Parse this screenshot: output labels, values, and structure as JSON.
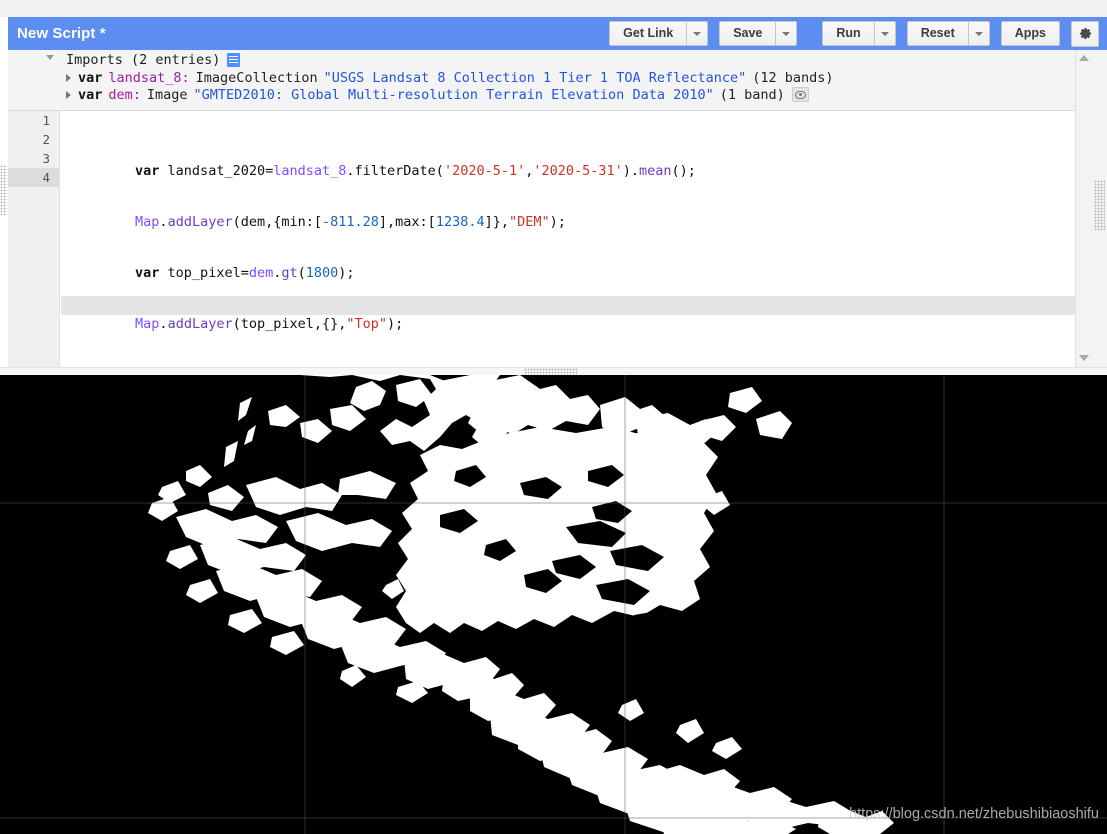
{
  "app": {
    "script_title": "New Script *"
  },
  "toolbar": {
    "get_link_label": "Get Link",
    "save_label": "Save",
    "run_label": "Run",
    "reset_label": "Reset",
    "apps_label": "Apps",
    "settings_icon": "gear-icon",
    "accent_color": "#5b8ef0"
  },
  "imports": {
    "title": "Imports (2 entries)",
    "list_icon": "document-list-icon",
    "entries": [
      {
        "keyword": "var",
        "name": "landsat_8:",
        "type": "ImageCollection",
        "description": "\"USGS Landsat 8 Collection 1 Tier 1 TOA Reflectance\"",
        "bands": "(12 bands)",
        "has_eye": false
      },
      {
        "keyword": "var",
        "name": "dem:",
        "type": "Image",
        "description": "\"GMTED2010: Global Multi-resolution Terrain Elevation Data 2010\"",
        "bands": "(1 band)",
        "has_eye": true,
        "eye_icon": "eye-icon"
      }
    ]
  },
  "editor": {
    "line_numbers": [
      "1",
      "2",
      "3",
      "4"
    ],
    "active_line": 4,
    "lines": [
      {
        "number": "1",
        "tokens": [
          {
            "t": "kw",
            "v": "var"
          },
          {
            "t": "plain",
            "v": " landsat_2020="
          },
          {
            "t": "obj",
            "v": "landsat_8"
          },
          {
            "t": "plain",
            "v": "."
          },
          {
            "t": "prop",
            "v": "filterDate"
          },
          {
            "t": "plain",
            "v": "("
          },
          {
            "t": "str",
            "v": "'2020-5-1'"
          },
          {
            "t": "plain",
            "v": ","
          },
          {
            "t": "str",
            "v": "'2020-5-31'"
          },
          {
            "t": "plain",
            "v": ")."
          },
          {
            "t": "fn",
            "v": "mean"
          },
          {
            "t": "plain",
            "v": "();"
          }
        ]
      },
      {
        "number": "2",
        "tokens": [
          {
            "t": "obj",
            "v": "Map"
          },
          {
            "t": "plain",
            "v": "."
          },
          {
            "t": "fn",
            "v": "addLayer"
          },
          {
            "t": "plain",
            "v": "(dem,{min:["
          },
          {
            "t": "num",
            "v": "-811.28"
          },
          {
            "t": "plain",
            "v": "],max:["
          },
          {
            "t": "num",
            "v": "1238.4"
          },
          {
            "t": "plain",
            "v": "]},"
          },
          {
            "t": "str",
            "v": "\"DEM\""
          },
          {
            "t": "plain",
            "v": ");"
          }
        ]
      },
      {
        "number": "3",
        "tokens": [
          {
            "t": "kw",
            "v": "var"
          },
          {
            "t": "plain",
            "v": " top_pixel="
          },
          {
            "t": "obj",
            "v": "dem"
          },
          {
            "t": "plain",
            "v": "."
          },
          {
            "t": "fn",
            "v": "gt"
          },
          {
            "t": "plain",
            "v": "("
          },
          {
            "t": "num",
            "v": "1800"
          },
          {
            "t": "plain",
            "v": ");"
          }
        ]
      },
      {
        "number": "4",
        "tokens": [
          {
            "t": "obj",
            "v": "Map"
          },
          {
            "t": "plain",
            "v": "."
          },
          {
            "t": "fn",
            "v": "addLayer"
          },
          {
            "t": "plain",
            "v": "(top_pixel,{},"
          },
          {
            "t": "str",
            "v": "\"Top\""
          },
          {
            "t": "plain",
            "v": ");"
          }
        ]
      }
    ],
    "raw_text": "var landsat_2020=landsat_8.filterDate('2020-5-1','2020-5-31').mean();\nMap.addLayer(dem,{min:[-811.28],max:[1238.4]},\"DEM\");\nvar top_pixel=dem.gt(1800);\nMap.addLayer(top_pixel,{},\"Top\");"
  },
  "map": {
    "background_color": "#000000",
    "mask_color": "#ffffff",
    "tile_line_color": "#3a3a3a",
    "vertical_tile_lines": [
      305,
      625,
      944
    ],
    "horizontal_tile_lines": [
      503,
      818
    ],
    "watermark": "https://blog.csdn.net/zhebushibiaoshifu"
  },
  "scrollbar": {
    "up_icon": "triangle-up-icon",
    "down_icon": "triangle-down-icon"
  }
}
